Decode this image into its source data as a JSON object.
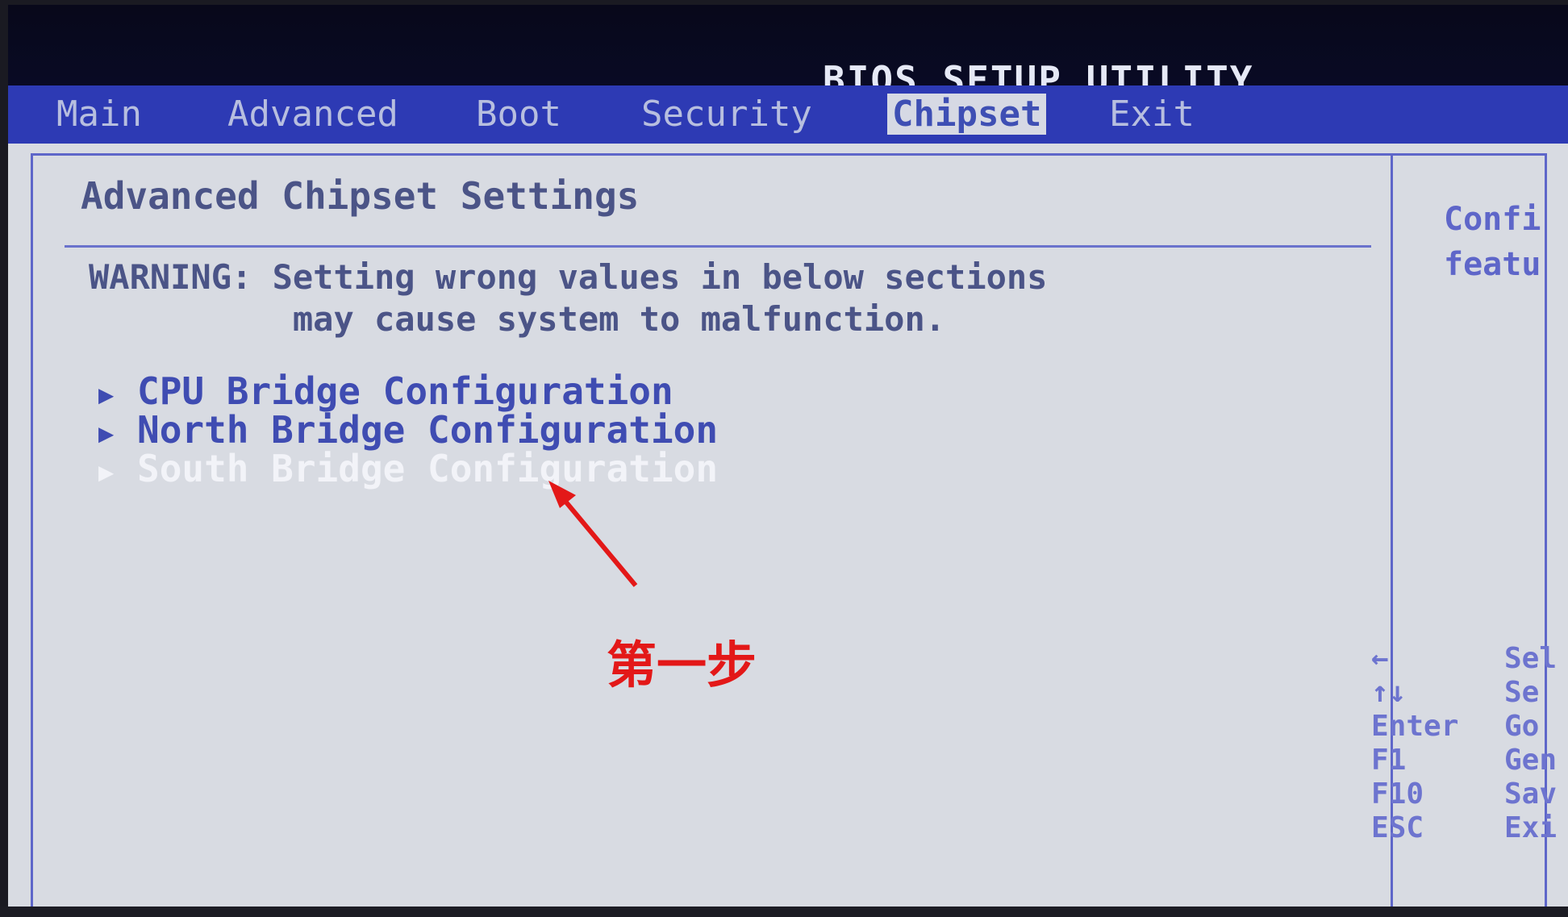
{
  "header": {
    "title": "BIOS SETUP UTILITY"
  },
  "tabs": [
    {
      "label": "Main",
      "active": false
    },
    {
      "label": "Advanced",
      "active": false
    },
    {
      "label": "Boot",
      "active": false
    },
    {
      "label": "Security",
      "active": false
    },
    {
      "label": "Chipset",
      "active": true
    },
    {
      "label": "Exit",
      "active": false
    }
  ],
  "main": {
    "heading": "Advanced Chipset Settings",
    "warning_label": "WARNING:",
    "warning_line1": "Setting wrong values in below sections",
    "warning_line2": "may cause system to malfunction.",
    "items": [
      {
        "label": "CPU Bridge Configuration",
        "selected": false
      },
      {
        "label": "North Bridge Configuration",
        "selected": false
      },
      {
        "label": "South Bridge Configuration",
        "selected": true
      }
    ],
    "arrow_glyph": "▶"
  },
  "help_panel": {
    "line1": "Confi",
    "line2": "featu"
  },
  "keys": [
    {
      "key": "←",
      "desc": "Sel"
    },
    {
      "key": "↑↓",
      "desc": "Se"
    },
    {
      "key": "Enter",
      "desc": "Go"
    },
    {
      "key": "F1",
      "desc": "Gen"
    },
    {
      "key": "F10",
      "desc": "Sav"
    },
    {
      "key": "ESC",
      "desc": "Exi"
    }
  ],
  "annotation": {
    "text": "第一步",
    "color": "#e31818"
  },
  "colors": {
    "menubar": "#2d3ab4",
    "panel": "#d8dbe2",
    "accent": "#5e66c9"
  }
}
